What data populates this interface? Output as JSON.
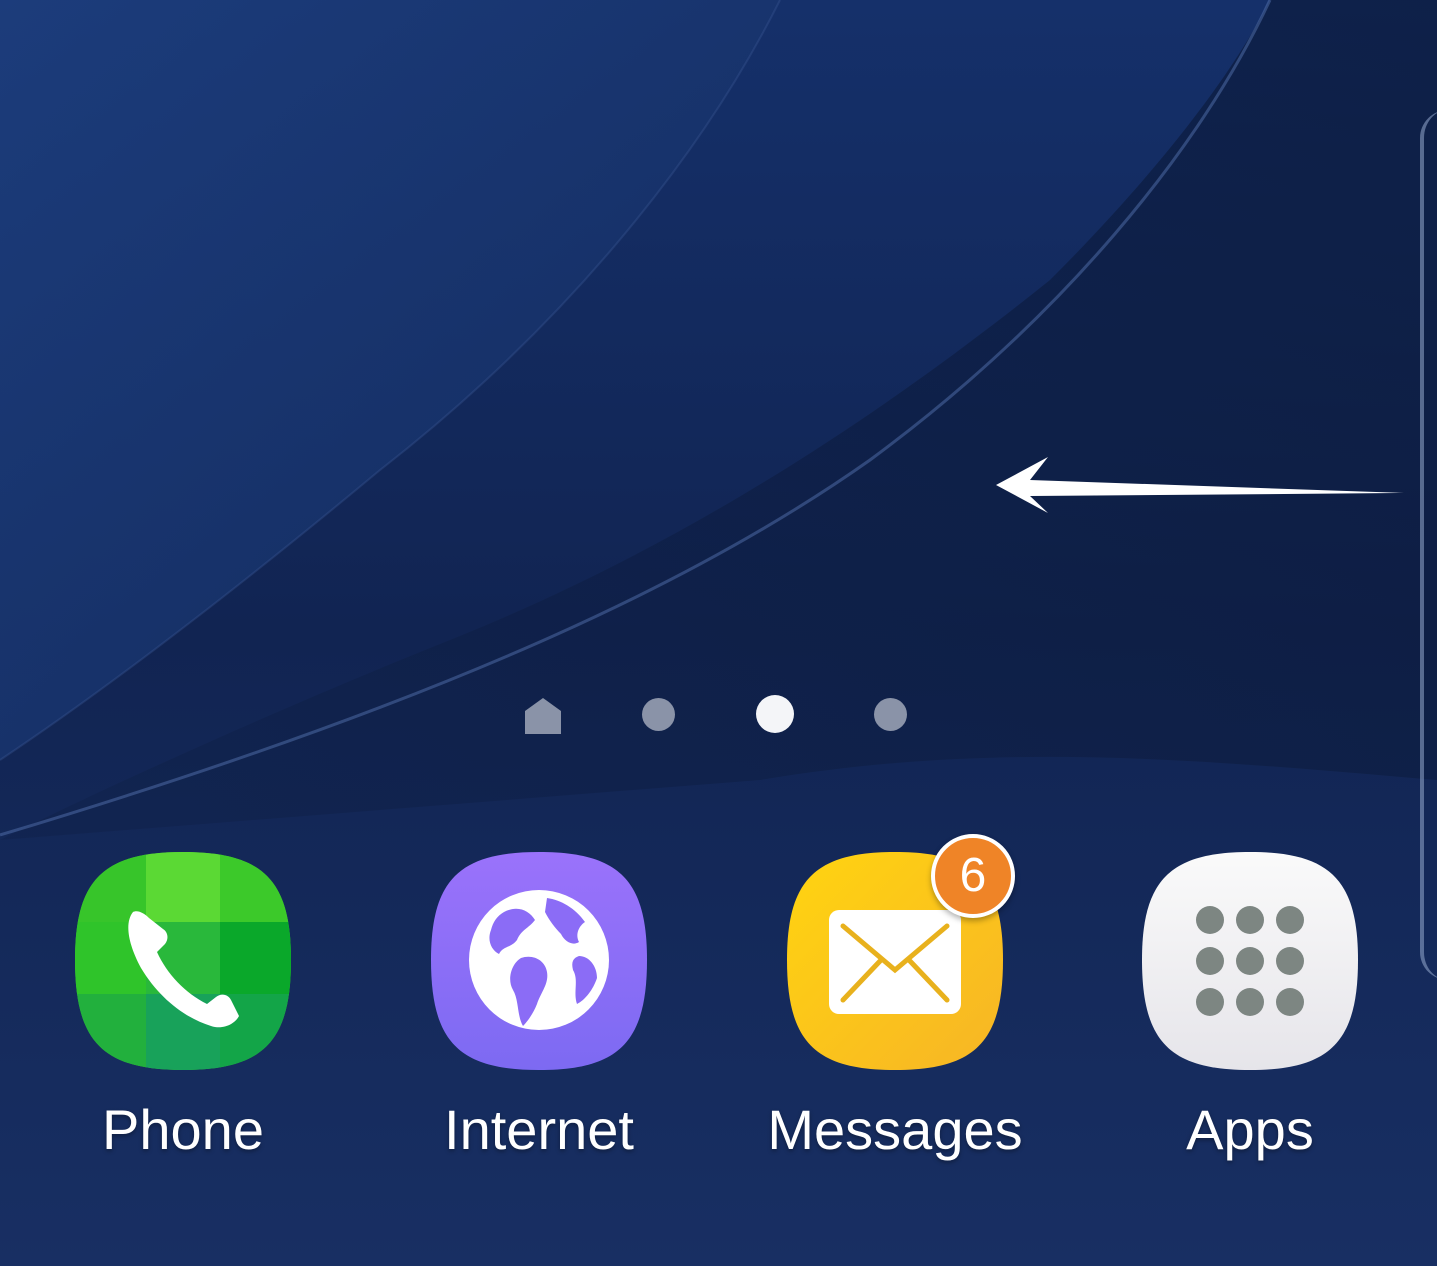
{
  "page_indicator": {
    "home_icon": "home-icon",
    "page_count": 3,
    "current_page": 2
  },
  "gesture_hint": {
    "icon": "arrow-left-icon",
    "direction": "left"
  },
  "edge_panel": {
    "icon": "edge-panel-handle"
  },
  "dock": {
    "apps": [
      {
        "label": "Phone",
        "icon": "phone-icon",
        "color": "#39c42a"
      },
      {
        "label": "Internet",
        "icon": "globe-icon",
        "color": "#8b6cf6"
      },
      {
        "label": "Messages",
        "icon": "envelope-icon",
        "color": "#fbbf1a",
        "badge": "6"
      },
      {
        "label": "Apps",
        "icon": "app-grid-icon",
        "color": "#f2f2f4"
      }
    ]
  },
  "colors": {
    "wallpaper_base": "#122550",
    "badge": "#ef8427"
  }
}
